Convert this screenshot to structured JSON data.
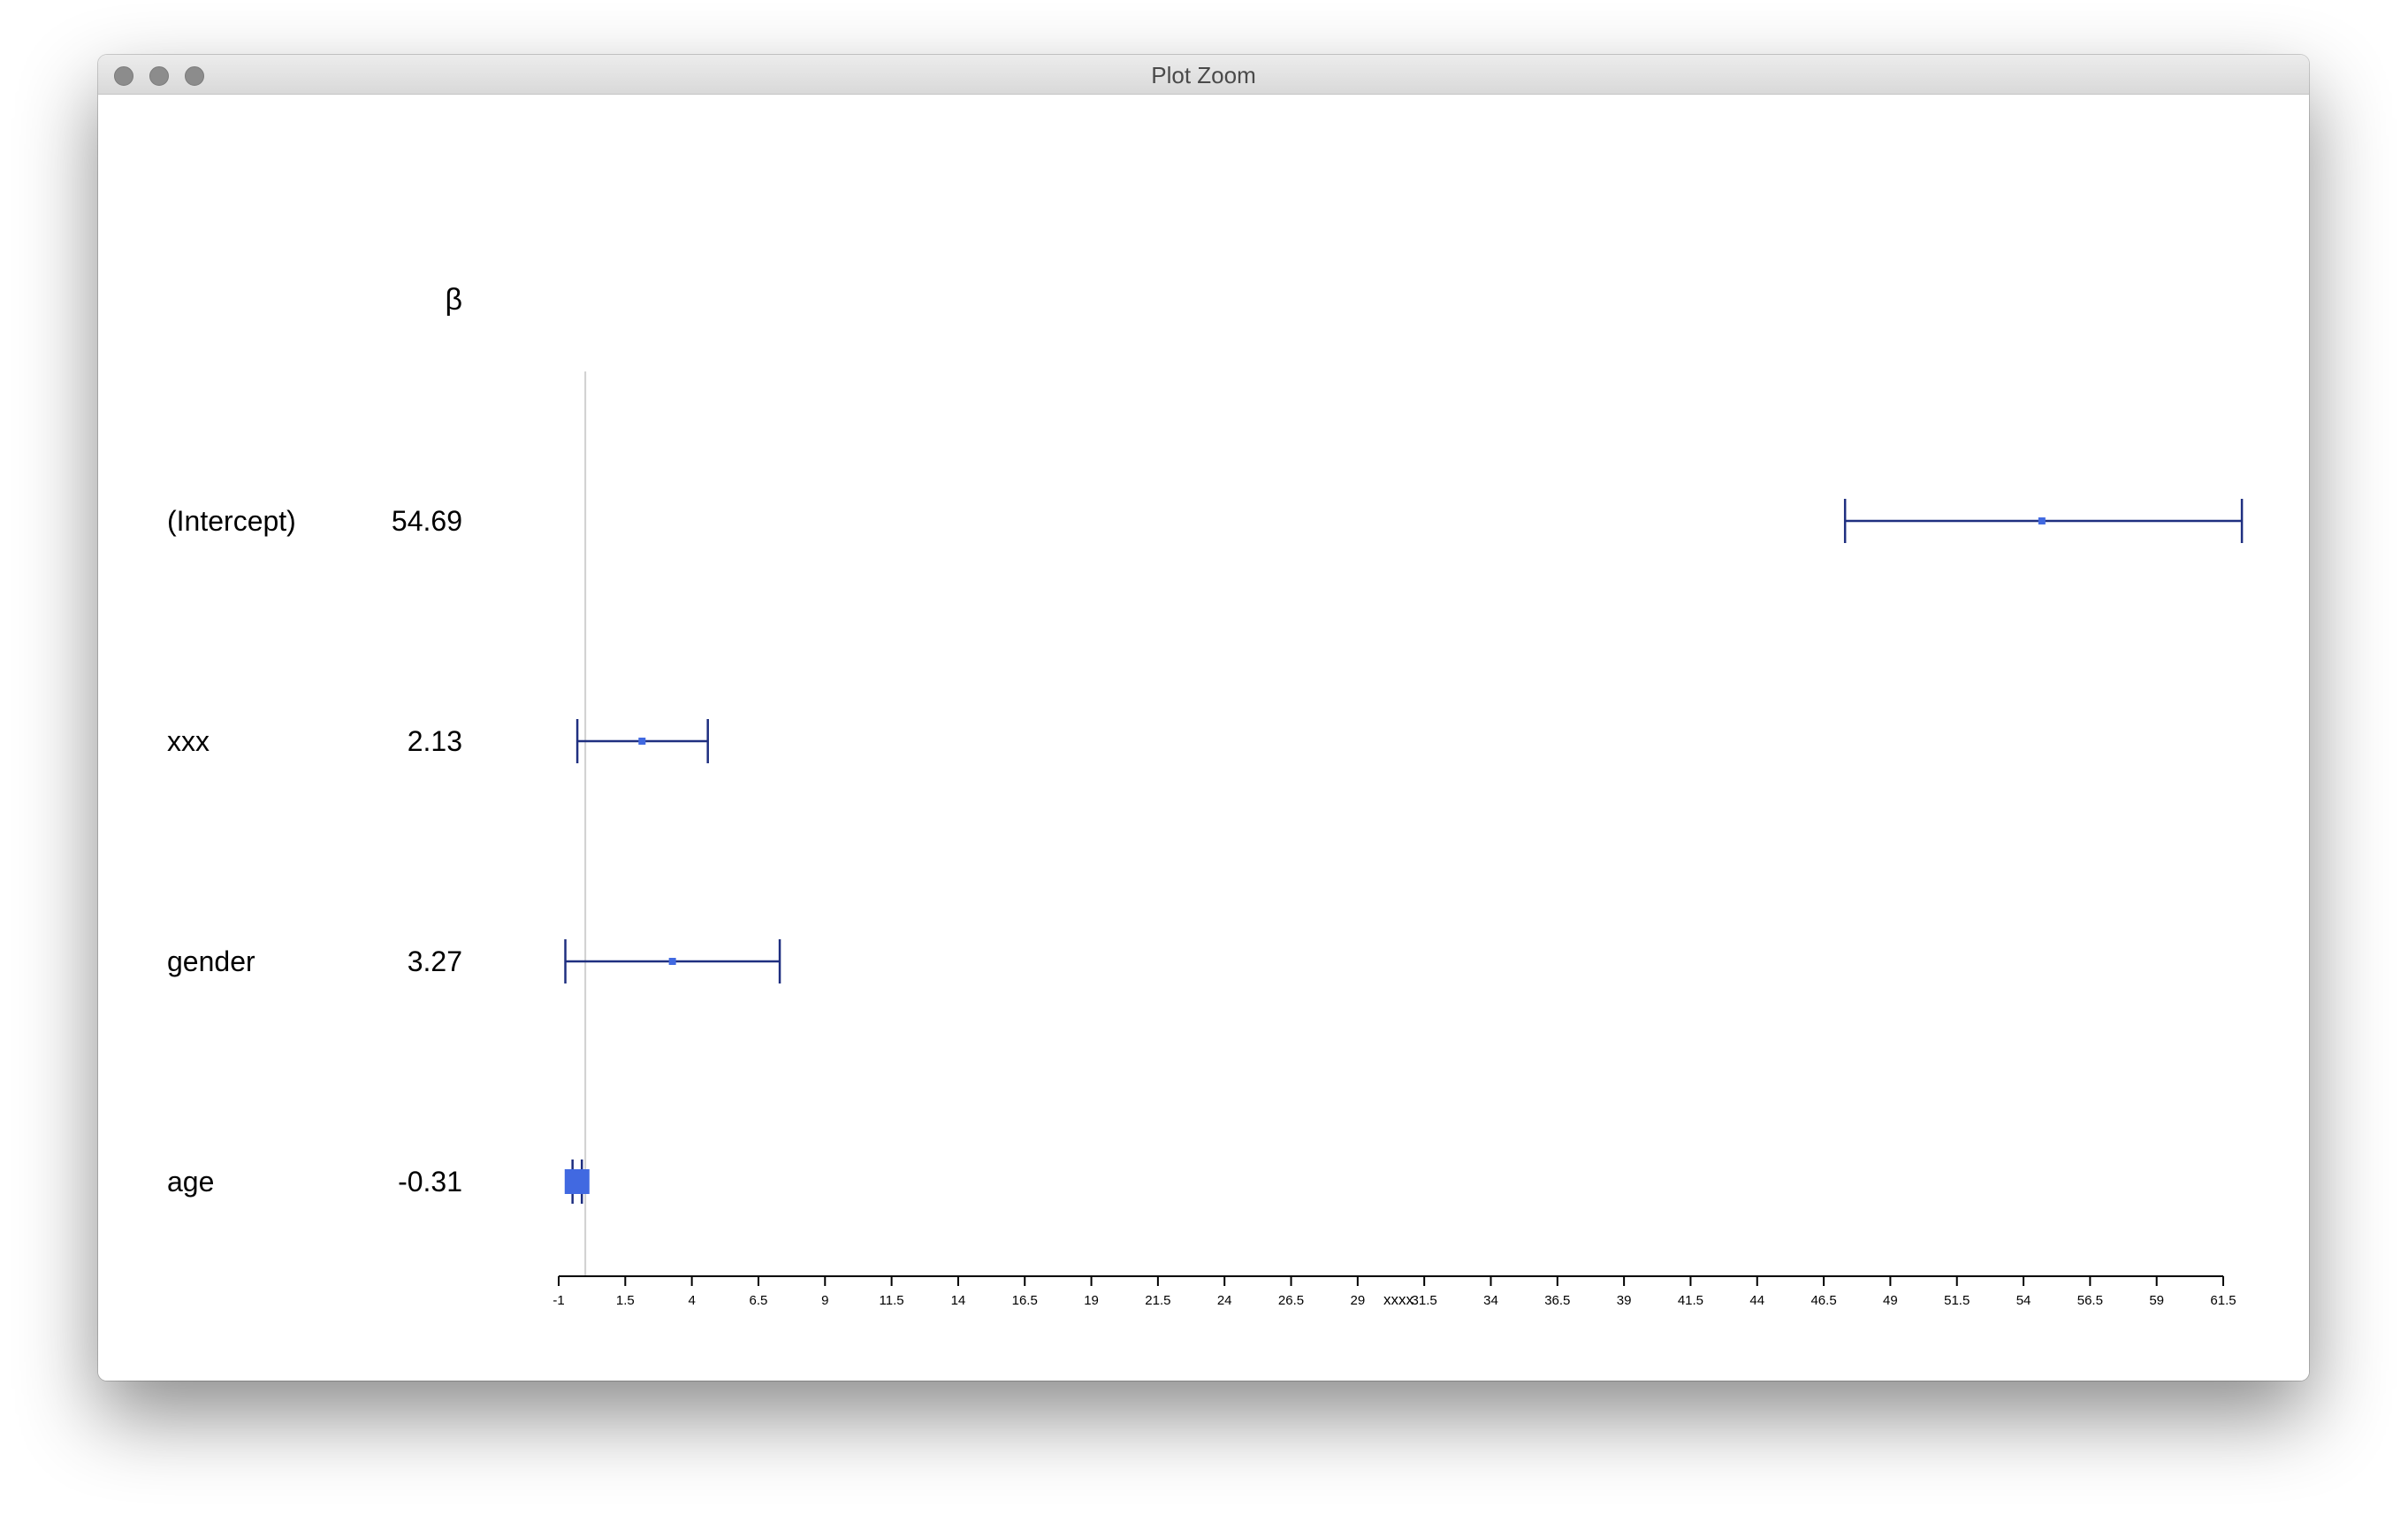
{
  "window": {
    "title": "Plot Zoom"
  },
  "colors": {
    "ci_line": "#1f2f80",
    "point": "#4169e1",
    "reference_line": "#d0d0d0",
    "axis": "#000000"
  },
  "chart_data": {
    "type": "forest",
    "title": "",
    "column_header": "β",
    "xlabel": "xxxx",
    "xlim": [
      -1,
      61.5
    ],
    "reference_line_x": 0,
    "x_ticks": [
      "-1",
      "1.5",
      "4",
      "6.5",
      "9",
      "11.5",
      "14",
      "16.5",
      "19",
      "21.5",
      "24",
      "26.5",
      "29",
      "31.5",
      "34",
      "36.5",
      "39",
      "41.5",
      "44",
      "46.5",
      "49",
      "51.5",
      "54",
      "56.5",
      "59",
      "61.5"
    ],
    "rows": [
      {
        "label": "(Intercept)",
        "beta_text": "54.69",
        "estimate": 54.69,
        "ci_low": 47.3,
        "ci_high": 62.2
      },
      {
        "label": "xxx",
        "beta_text": "2.13",
        "estimate": 2.13,
        "ci_low": -0.3,
        "ci_high": 4.6
      },
      {
        "label": "gender",
        "beta_text": "3.27",
        "estimate": 3.27,
        "ci_low": -0.75,
        "ci_high": 7.3
      },
      {
        "label": "age",
        "beta_text": "-0.31",
        "estimate": -0.31,
        "ci_low": -0.48,
        "ci_high": -0.13
      }
    ]
  }
}
